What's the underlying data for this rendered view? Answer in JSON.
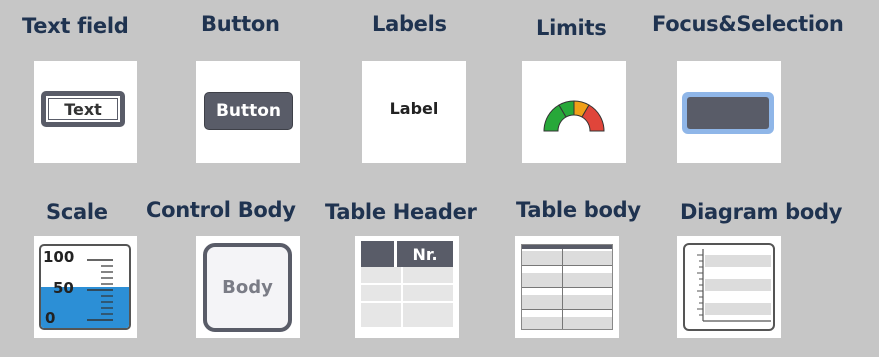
{
  "captions": {
    "text_field": "Text field",
    "button": "Button",
    "labels": "Labels",
    "limits": "Limits",
    "focus_selection": "Focus&Selection",
    "scale": "Scale",
    "control_body": "Control Body",
    "table_header": "Table Header",
    "table_body": "Table body",
    "diagram_body": "Diagram body"
  },
  "samples": {
    "text_field_value": "Text",
    "button_label": "Button",
    "label_text": "Label",
    "body_text": "Body",
    "header_text": "Nr."
  },
  "scale": {
    "ticks": [
      "100",
      "50",
      "0"
    ],
    "level_percent": 50
  },
  "colors": {
    "background": "#c6c6c6",
    "caption": "#1f3350",
    "dark_gray": "#595c68",
    "focus_blue": "#8fb6e8",
    "scale_fill": "#2c8fd6",
    "gauge_green": "#27a839",
    "gauge_yellow": "#f0a019",
    "gauge_red": "#e0453a"
  },
  "icons": [
    "gauge-icon",
    "scale-icon",
    "table-header-icon",
    "table-body-icon",
    "diagram-body-icon"
  ]
}
